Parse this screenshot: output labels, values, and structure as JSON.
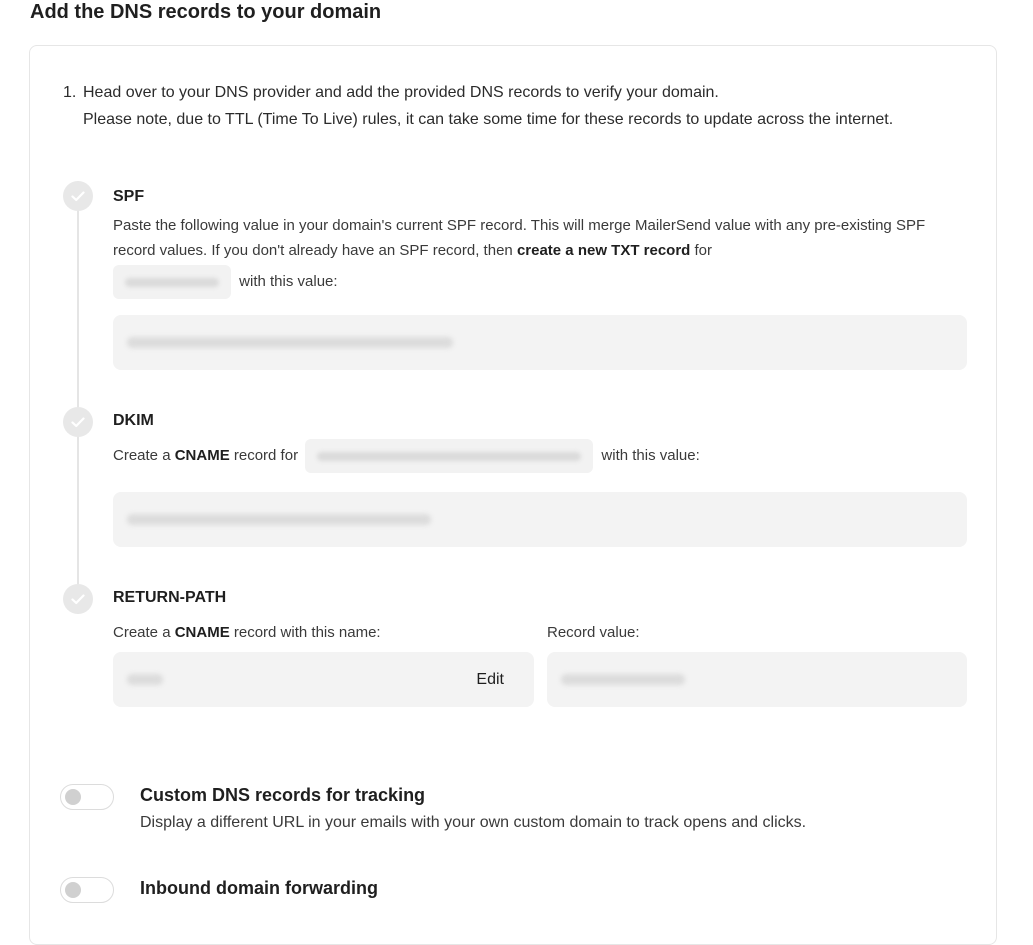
{
  "page": {
    "heading": "Add the DNS records to your domain"
  },
  "intro": {
    "number": "1.",
    "line1": "Head over to your DNS provider and add the provided DNS records to verify your domain.",
    "line2": "Please note, due to TTL (Time To Live) rules, it can take some time for these records to update across the internet."
  },
  "steps": {
    "spf": {
      "title": "SPF",
      "text_before": "Paste the following value in your domain's current SPF record. This will merge MailerSend value with any pre-existing SPF record values. If you don't already have an SPF record, then ",
      "text_bold": "create a new TXT record",
      "text_after": " for",
      "text_tail": "with this value:"
    },
    "dkim": {
      "title": "DKIM",
      "text_before": "Create a ",
      "text_bold": "CNAME",
      "text_mid": " record for",
      "text_tail": "with this value:"
    },
    "return_path": {
      "title": "RETURN-PATH",
      "name_label_before": "Create a ",
      "name_label_bold": "CNAME",
      "name_label_after": " record with this name:",
      "value_label": "Record value:",
      "edit_label": "Edit"
    }
  },
  "options": [
    {
      "title": "Custom DNS records for tracking",
      "description": "Display a different URL in your emails with your own custom domain to track opens and clicks.",
      "enabled": false
    },
    {
      "title": "Inbound domain forwarding",
      "description": "",
      "enabled": false
    }
  ],
  "colors": {
    "card_border": "#e6e6e6",
    "field_bg": "#f3f3f3",
    "step_icon_bg": "#e8e8e8",
    "check": "#ffffff"
  },
  "icons": {
    "step": "check-circle-icon"
  }
}
